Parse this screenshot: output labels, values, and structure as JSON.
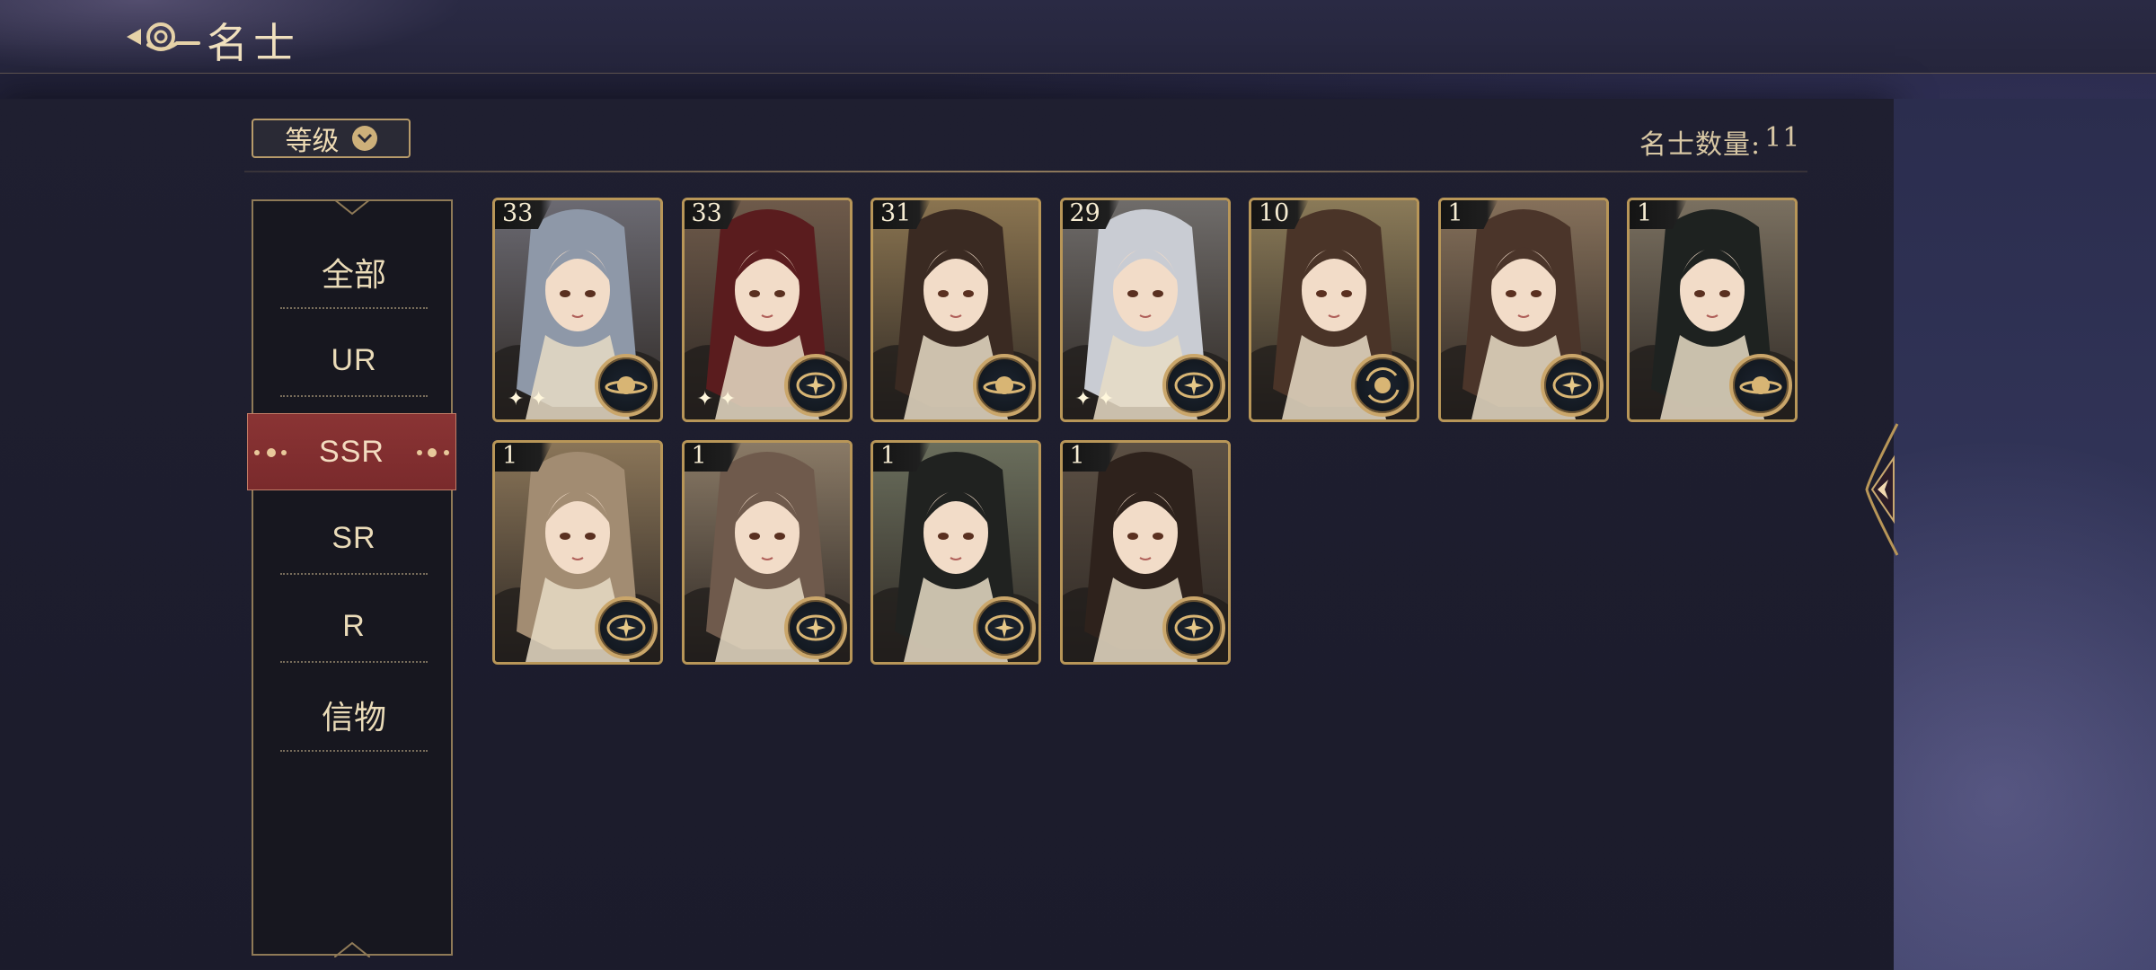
{
  "header": {
    "title": "名士"
  },
  "toolbar": {
    "sort_label": "等级",
    "count_label": "名士数量:",
    "count_value": "11"
  },
  "categories": {
    "items": [
      "全部",
      "UR",
      "SSR",
      "SR",
      "R",
      "信物"
    ],
    "selected": "SSR"
  },
  "cards": [
    {
      "level": "33",
      "badge": "planet",
      "hair": "#8e98a8",
      "bg": "#6b6a72",
      "sparkles": true
    },
    {
      "level": "33",
      "badge": "compass",
      "hair": "#5a1c1e",
      "bg": "#6e5a4a",
      "sparkles": true
    },
    {
      "level": "31",
      "badge": "planet",
      "hair": "#3a2a22",
      "bg": "#8a7450",
      "sparkles": false
    },
    {
      "level": "29",
      "badge": "compass",
      "hair": "#c9ccd3",
      "bg": "#6f6c6a",
      "sparkles": true
    },
    {
      "level": "10",
      "badge": "orbit",
      "hair": "#4a3428",
      "bg": "#8a7a58",
      "sparkles": false
    },
    {
      "level": "1",
      "badge": "compass",
      "hair": "#4b352a",
      "bg": "#85705a",
      "sparkles": false
    },
    {
      "level": "1",
      "badge": "planet",
      "hair": "#1e2220",
      "bg": "#7a7060",
      "sparkles": false
    },
    {
      "level": "1",
      "badge": "compass",
      "hair": "#a28c72",
      "bg": "#8a7558",
      "sparkles": false
    },
    {
      "level": "1",
      "badge": "compass",
      "hair": "#6f5a4c",
      "bg": "#8a7a66",
      "sparkles": false
    },
    {
      "level": "1",
      "badge": "compass",
      "hair": "#202220",
      "bg": "#6a6e5c",
      "sparkles": false
    },
    {
      "level": "1",
      "badge": "compass",
      "hair": "#2e221c",
      "bg": "#5c5044",
      "sparkles": false
    }
  ]
}
